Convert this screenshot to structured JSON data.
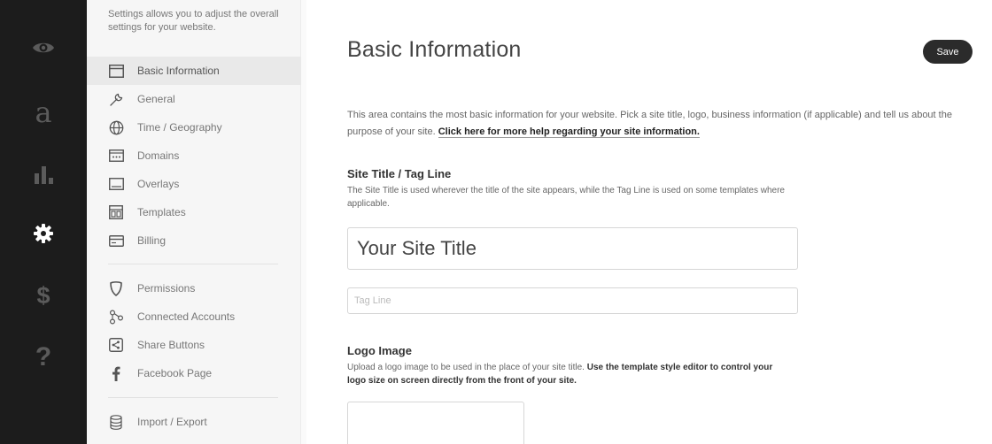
{
  "rail": {
    "items": [
      {
        "icon": "eye-icon"
      },
      {
        "icon": "letter-a-icon",
        "glyph": "a"
      },
      {
        "icon": "bar-chart-icon"
      },
      {
        "icon": "gear-icon"
      },
      {
        "icon": "dollar-icon",
        "glyph": "$"
      },
      {
        "icon": "question-icon",
        "glyph": "?"
      }
    ]
  },
  "sidebar": {
    "description": "Settings allows you to adjust the overall settings for your website.",
    "items": [
      {
        "label": "Basic Information",
        "icon": "window-icon"
      },
      {
        "label": "General",
        "icon": "wrench-icon"
      },
      {
        "label": "Time / Geography",
        "icon": "globe-icon"
      },
      {
        "label": "Domains",
        "icon": "domains-icon"
      },
      {
        "label": "Overlays",
        "icon": "overlay-icon"
      },
      {
        "label": "Templates",
        "icon": "templates-icon"
      },
      {
        "label": "Billing",
        "icon": "card-icon"
      },
      {
        "label": "Permissions",
        "icon": "shield-icon"
      },
      {
        "label": "Connected Accounts",
        "icon": "connected-icon"
      },
      {
        "label": "Share Buttons",
        "icon": "share-icon"
      },
      {
        "label": "Facebook Page",
        "icon": "facebook-icon"
      },
      {
        "label": "Import / Export",
        "icon": "database-icon"
      }
    ]
  },
  "main": {
    "title": "Basic Information",
    "save_label": "Save",
    "intro_text": "This area contains the most basic information for your website. Pick a site title, logo, business information (if applicable) and tell us about the purpose of your site. ",
    "intro_link": "Click here for more help regarding your site information.",
    "site_title_section": {
      "heading": "Site Title / Tag Line",
      "description": "The Site Title is used wherever the title of the site appears, while the Tag Line is used on some templates where applicable.",
      "title_value": "Your Site Title",
      "tagline_placeholder": "Tag Line"
    },
    "logo_section": {
      "heading": "Logo Image",
      "description": "Upload a logo image to be used in the place of your site title. ",
      "description_bold": "Use the template style editor to control your logo size on screen directly from the front of your site."
    }
  }
}
